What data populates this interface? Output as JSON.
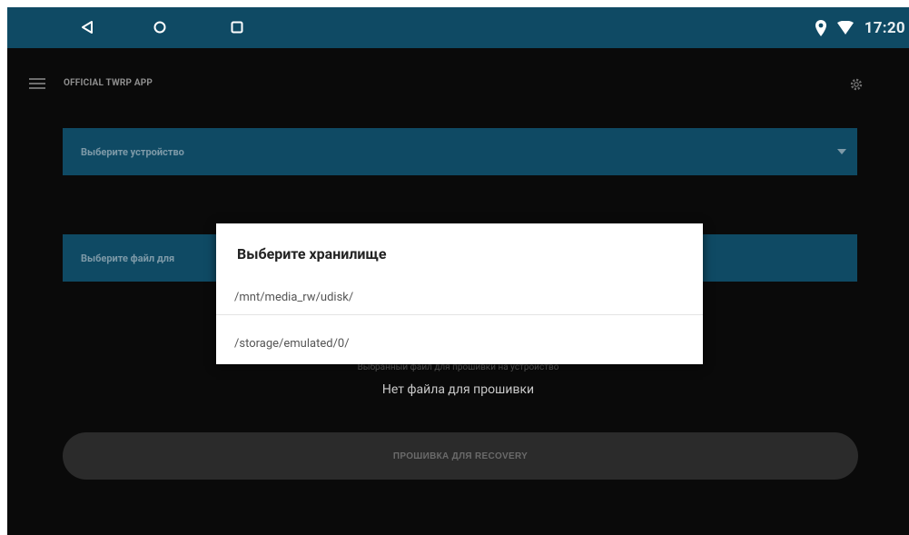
{
  "status_bar": {
    "time": "17:20",
    "nav": [
      "back-icon",
      "home-icon",
      "recents-icon"
    ],
    "indicators": [
      "location-icon",
      "wifi-icon"
    ],
    "background": "#0f4a64"
  },
  "app_bar": {
    "title": "OFFICIAL TWRP APP",
    "menu_icon": "menu-icon",
    "settings_icon": "gear-icon"
  },
  "main": {
    "device_select_label": "Выберите устройство",
    "file_select_label": "Выберите файл для",
    "selected_hint": "Выбранный файл для прошивки на устройство",
    "no_file": "Нет файла для прошивки",
    "flash_button": "ПРОШИВКА ДЛЯ RECOVERY",
    "accent": "#0f4a64"
  },
  "dialog": {
    "title": "Выберите хранилище",
    "options": [
      "/mnt/media_rw/udisk/",
      "/storage/emulated/0/"
    ]
  }
}
